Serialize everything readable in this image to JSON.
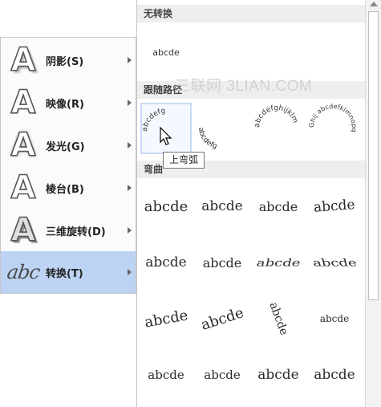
{
  "left_menu": {
    "items": [
      {
        "label": "阴影(S)",
        "icon": "text-shadow-icon"
      },
      {
        "label": "映像(R)",
        "icon": "text-reflection-icon"
      },
      {
        "label": "发光(G)",
        "icon": "text-glow-icon"
      },
      {
        "label": "棱台(B)",
        "icon": "text-bevel-icon"
      },
      {
        "label": "三维旋转(D)",
        "icon": "text-3d-rotation-icon"
      },
      {
        "label": "转换(T)",
        "icon": "text-transform-icon",
        "active": true
      }
    ],
    "icon_letter": "A",
    "transform_icon_text": "abc"
  },
  "panel": {
    "sections": {
      "none": "无转换",
      "follow_path": "跟随路径",
      "warp": "弯曲"
    },
    "sample_text": "abcde",
    "path_samples": [
      "abcdefg",
      "abcdefg",
      "abcdefghijklm",
      "Ghij abcdefklmnopq"
    ],
    "warp_samples": [
      "abcde",
      "abcde",
      "abcde",
      "abcde",
      "abcde",
      "abcde",
      "abcde",
      "abcde",
      "abcde",
      "abcde",
      "abcde",
      "abcde",
      "abcde",
      "abcde",
      "abcde",
      "abcde"
    ],
    "tooltip": "上弯弧"
  },
  "watermark": "三联网 3LIAN.COM",
  "colors": {
    "active_bg": "#bcd3f3",
    "header_bg": "#eeeeee",
    "border": "#c6c6c6"
  }
}
